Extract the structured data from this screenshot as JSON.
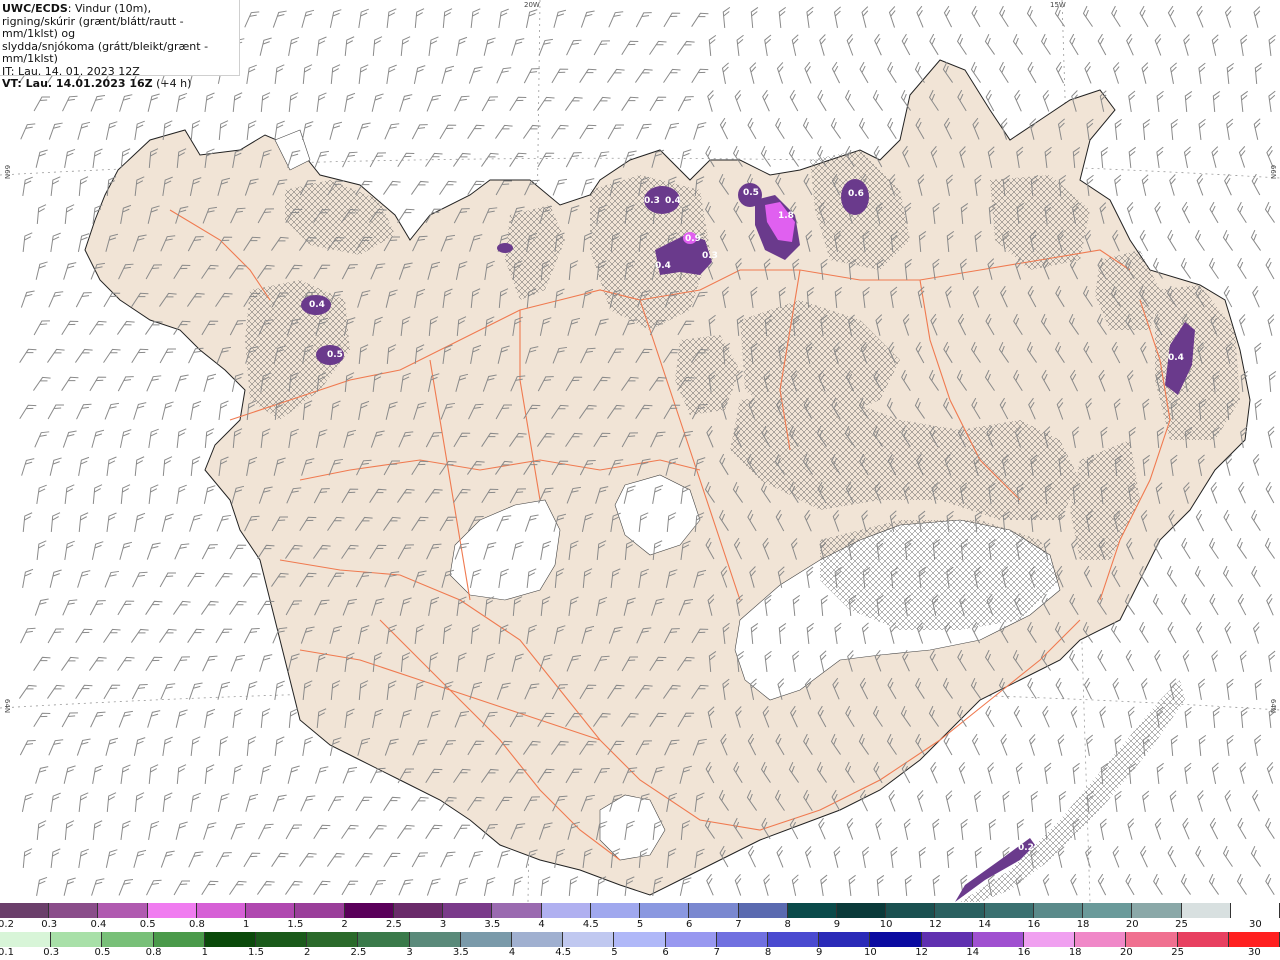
{
  "info": {
    "title_bold": "UWC/ECDS",
    "title_rest": ": Vindur (10m),",
    "line2": "rigning/skúrir (grænt/blátt/rautt - mm/1klst) og",
    "line3": "slydda/snjókoma (grátt/bleikt/grænt - mm/1klst)",
    "line4": "IT: Lau. 14. 01. 2023 12Z",
    "line5_bold": "VT: Lau. 14.01.2023 16Z",
    "line5_rest": " (+4 h)"
  },
  "axis_labels": {
    "top_20w": "20W",
    "top_15w": "15W",
    "left_66n": "66N",
    "right_66n": "66N",
    "left_64n": "64N",
    "right_64n": "64N"
  },
  "map_labels": [
    "0.4",
    "0.5",
    "0.3",
    "0.4",
    "0.9",
    "0.4",
    "0.3",
    "0.5",
    "1.8",
    "0.6",
    "0.4",
    "0.2"
  ],
  "colors": {
    "land": "#f1e4d6",
    "glacier": "#ffffff",
    "road": "#f07a50",
    "coast": "#222222",
    "wind": "#8a8a8a",
    "snow_purple": "#6a3a8c",
    "snow_magenta": "#e060f0"
  },
  "legend_snow": {
    "labels": [
      "0.2",
      "0.3",
      "0.4",
      "0.5",
      "0.8",
      "1",
      "1.5",
      "2",
      "2.5",
      "3",
      "3.5",
      "4",
      "4.5",
      "5",
      "6",
      "7",
      "8",
      "9",
      "10",
      "12",
      "14",
      "16",
      "18",
      "20",
      "25",
      "30"
    ],
    "colors": [
      "#6b3f6b",
      "#8a4d8a",
      "#b05ab0",
      "#f07cf0",
      "#d660d6",
      "#b048b0",
      "#9a3e9a",
      "#5a005a",
      "#6a2a6a",
      "#7a3a8a",
      "#9a6ab0",
      "#b0b0f0",
      "#a0a8ee",
      "#8a98e0",
      "#7a88d0",
      "#5a6ab0",
      "#0a4a4a",
      "#0a3a3a",
      "#1a5050",
      "#2a6060",
      "#3a7070",
      "#5a8a8a",
      "#6a9a9a",
      "#8aa8a8",
      "#d8e0e0",
      "#ffffff"
    ]
  },
  "legend_rain": {
    "labels": [
      "0.1",
      "0.3",
      "0.5",
      "0.8",
      "1",
      "1.5",
      "2",
      "2.5",
      "3",
      "3.5",
      "4",
      "4.5",
      "5",
      "6",
      "7",
      "8",
      "9",
      "10",
      "12",
      "14",
      "16",
      "18",
      "20",
      "25",
      "30"
    ],
    "colors": [
      "#d8f5d8",
      "#a8e0a8",
      "#78c078",
      "#4a9a4a",
      "#0a4a0a",
      "#1a5a1a",
      "#2a6a2a",
      "#3a7a4a",
      "#5a8a7a",
      "#7a9aaa",
      "#a0b0d0",
      "#c0c8f0",
      "#b0b8f8",
      "#9898f0",
      "#7070e0",
      "#4a4ad0",
      "#2a2ab8",
      "#0a0aa0",
      "#6030b0",
      "#a050d0",
      "#f0a0f0",
      "#f088c8",
      "#f07090",
      "#e84060",
      "#ff2020"
    ]
  }
}
